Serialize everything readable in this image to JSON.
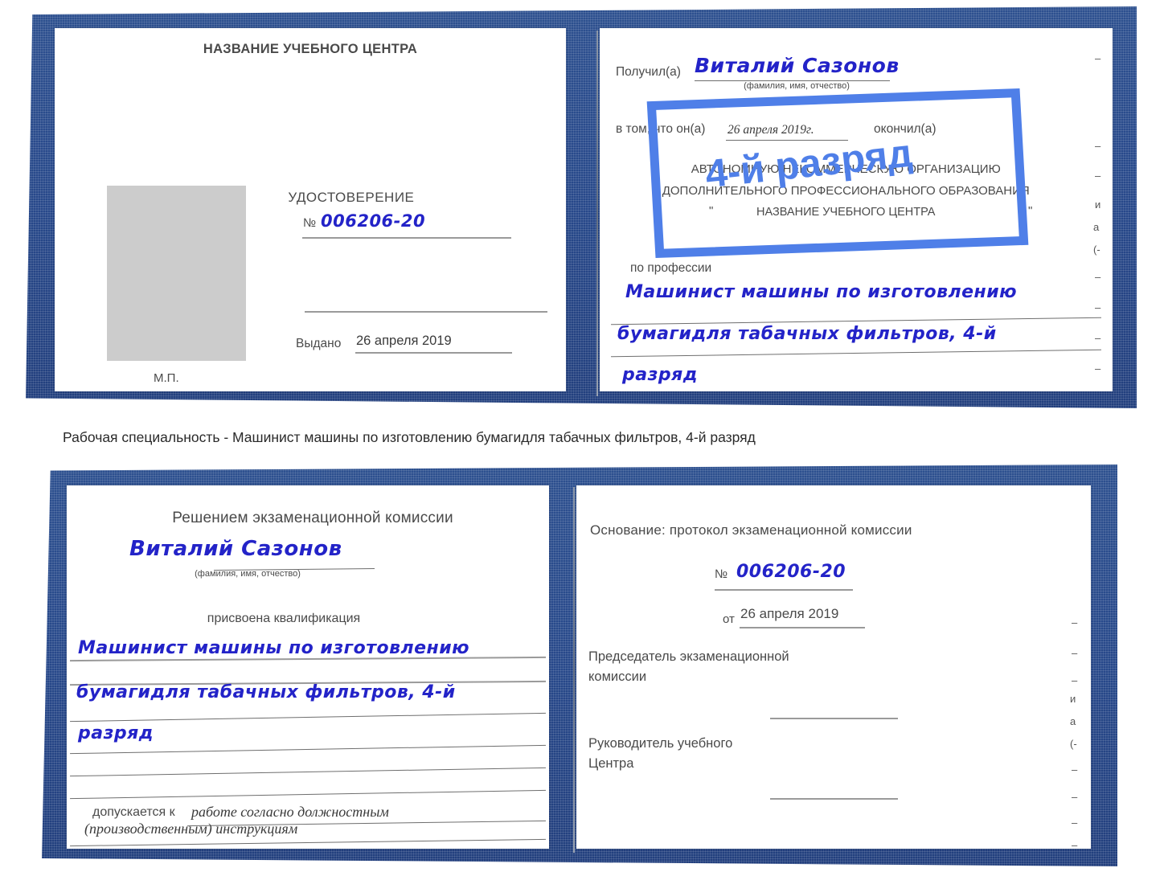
{
  "document": {
    "type": "udostoverenie-certificate-scan",
    "language": "ru",
    "colors": {
      "cover_blue": "#27488a",
      "ink_blue": "#2323c8",
      "stamp_blue": "#4f7fe8",
      "photo_placeholder": "#cccccc",
      "paper": "#ffffff",
      "text_gray": "#4a4a4a"
    }
  },
  "caption": {
    "text": "Рабочая специальность - Машинист машины по изготовлению бумагидля табачных фильтров, 4-й разряд"
  },
  "certificate_top": {
    "left_page": {
      "header": "НАЗВАНИЕ УЧЕБНОГО ЦЕНТРА",
      "title": "УДОСТОВЕРЕНИЕ",
      "number_label": "№",
      "number_value": "006206-20",
      "issued_label": "Выдано",
      "issued_value": "26 апреля 2019",
      "seal_label": "М.П.",
      "photo_placeholder_name": "photo-placeholder"
    },
    "right_page": {
      "received_label": "Получил(а)",
      "received_value": "Виталий Сазонов",
      "received_hint": "(фамилия, имя, отчество)",
      "statement_prefix": "в том, что он(а)",
      "statement_date": "26 апреля 2019г.",
      "statement_suffix": "окончил(а)",
      "org_line_1": "АВТОНОМНУЮ НЕКОММЕРЧЕСКУЮ ОРГАНИЗАЦИЮ",
      "org_line_2": "ДОПОЛНИТЕЛЬНОГО ПРОФЕССИОНАЛЬНОГО ОБРАЗОВАНИЯ",
      "org_quote_open": "\"",
      "org_line_3": "НАЗВАНИЕ УЧЕБНОГО ЦЕНТРА",
      "org_quote_close": "\"",
      "profession_label": "по профессии",
      "profession_line_1": "Машинист машины по изготовлению",
      "profession_line_2": "бумагидля табачных фильтров, 4-й",
      "profession_line_3": "разряд",
      "edge_fragments": [
        "–",
        "–",
        "–",
        "и",
        "а",
        "(-",
        "–",
        "–",
        "–",
        "–"
      ]
    },
    "watermark": {
      "text": "4-й разряд"
    }
  },
  "certificate_bottom": {
    "left_page": {
      "header": "Решением экзаменационной комиссии",
      "name_value": "Виталий Сазонов",
      "name_hint": "(фамилия, имя, отчество)",
      "qualification_label": "присвоена квалификация",
      "qualification_line_1": "Машинист машины по изготовлению",
      "qualification_line_2": "бумагидля табачных фильтров, 4-й",
      "qualification_line_3": "разряд",
      "admitted_label": "допускается к",
      "admitted_value_1": "работе согласно должностным",
      "admitted_value_2": "(производственным) инструкциям"
    },
    "right_page": {
      "basis_label": "Основание: протокол экзаменационной комиссии",
      "number_label": "№",
      "number_value": "006206-20",
      "date_label": "от",
      "date_value": "26 апреля 2019",
      "chairman_line_1": "Председатель экзаменационной",
      "chairman_line_2": "комиссии",
      "head_line_1": "Руководитель учебного",
      "head_line_2": "Центра",
      "edge_fragments": [
        "–",
        "–",
        "–",
        "и",
        "а",
        "(-",
        "–",
        "–",
        "–",
        "–"
      ]
    }
  }
}
